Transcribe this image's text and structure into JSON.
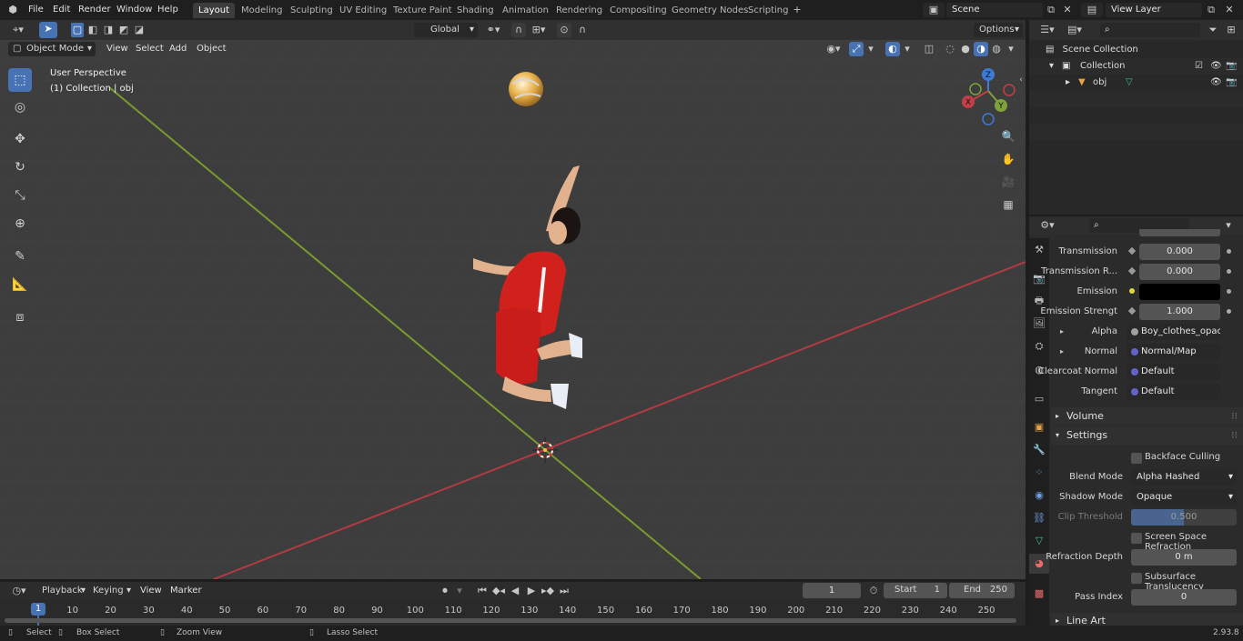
{
  "menu": [
    "File",
    "Edit",
    "Render",
    "Window",
    "Help"
  ],
  "workspaces": [
    "Layout",
    "Modeling",
    "Sculpting",
    "UV Editing",
    "Texture Paint",
    "Shading",
    "Animation",
    "Rendering",
    "Compositing",
    "Geometry Nodes",
    "Scripting"
  ],
  "active_workspace": "Layout",
  "scene_name": "Scene",
  "view_layer": "View Layer",
  "viewport_header": {
    "mode": "Object Mode",
    "menus": [
      "View",
      "Select",
      "Add",
      "Object"
    ],
    "transform_orientation": "Global",
    "options_label": "Options"
  },
  "viewport_overlay": {
    "perspective": "User Perspective",
    "collection_info": "(1) Collection | obj"
  },
  "gizmo_axes": [
    "X",
    "Y",
    "Z"
  ],
  "outliner": {
    "scene_collection": "Scene Collection",
    "collection": "Collection",
    "object": "obj"
  },
  "properties": {
    "rows": [
      {
        "label": "Transmission",
        "value": "0.000"
      },
      {
        "label": "Transmission R...",
        "value": "0.000"
      },
      {
        "label": "Emission",
        "value": ""
      },
      {
        "label": "Emission Strengt",
        "value": "1.000"
      }
    ],
    "links": [
      {
        "label": "Alpha",
        "value": "Boy_clothes_opacity..."
      },
      {
        "label": "Normal",
        "value": "Normal/Map"
      },
      {
        "label": "Clearcoat Normal",
        "value": "Default"
      },
      {
        "label": "Tangent",
        "value": "Default"
      }
    ],
    "sections": {
      "volume": "Volume",
      "settings": "Settings",
      "line_art": "Line Art"
    },
    "settings": {
      "backface_culling": "Backface Culling",
      "blend_mode_label": "Blend Mode",
      "blend_mode": "Alpha Hashed",
      "shadow_mode_label": "Shadow Mode",
      "shadow_mode": "Opaque",
      "clip_threshold_label": "Clip Threshold",
      "clip_threshold": "0.500",
      "screen_space_refraction": "Screen Space Refraction",
      "refraction_depth_label": "Refraction Depth",
      "refraction_depth": "0 m",
      "subsurface_translucency": "Subsurface Translucency",
      "pass_index_label": "Pass Index",
      "pass_index": "0"
    }
  },
  "timeline": {
    "menus": [
      "Playback",
      "Keying",
      "View",
      "Marker"
    ],
    "current_frame": "1",
    "start_label": "Start",
    "start": "1",
    "end_label": "End",
    "end": "250",
    "ticks": [
      "1",
      "10",
      "20",
      "30",
      "40",
      "50",
      "60",
      "70",
      "80",
      "90",
      "100",
      "110",
      "120",
      "130",
      "140",
      "150",
      "160",
      "170",
      "180",
      "190",
      "200",
      "210",
      "220",
      "230",
      "240",
      "250"
    ]
  },
  "statusbar": {
    "select": "Select",
    "box_select": "Box Select",
    "zoom_view": "Zoom View",
    "lasso_select": "Lasso Select",
    "version": "2.93.8"
  },
  "colors": {
    "accent": "#4772b3",
    "x_axis": "#c33f47",
    "y_axis": "#7ea33a",
    "z_axis": "#3c7bd6"
  }
}
